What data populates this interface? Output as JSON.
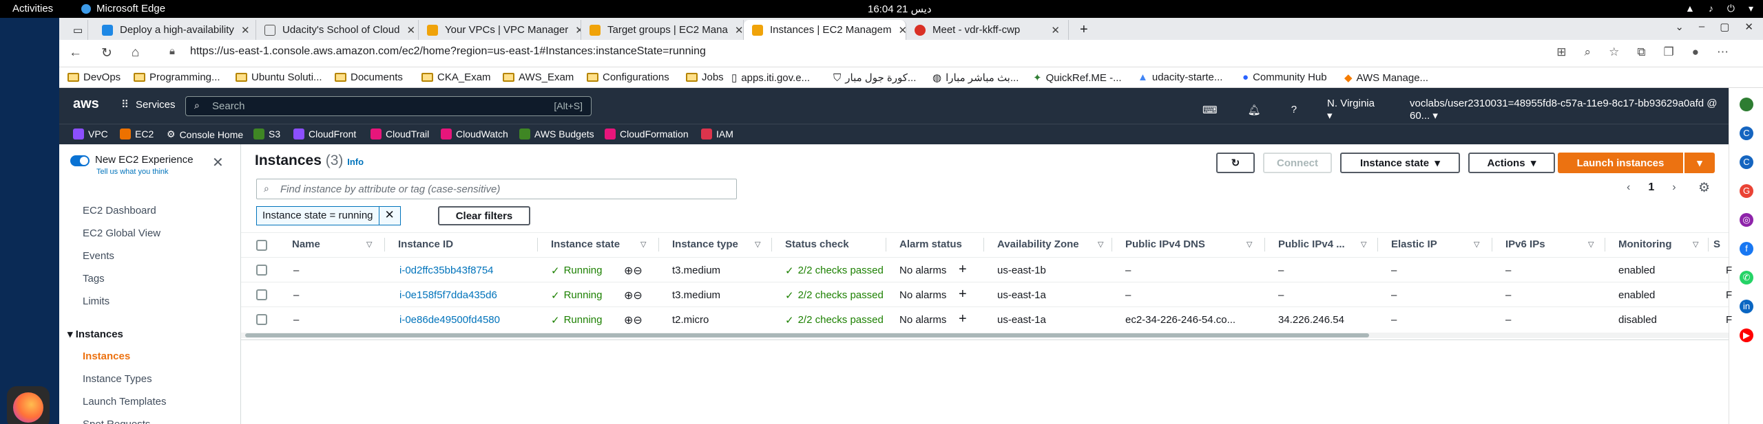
{
  "gnome": {
    "activities": "Activities",
    "app": "Microsoft Edge",
    "clock": "16:04  21 ديس"
  },
  "tabs": [
    {
      "title": "Deploy a high-availability",
      "color": "#1e88e5"
    },
    {
      "title": "Udacity's School of Cloud",
      "color": "#555"
    },
    {
      "title": "Your VPCs | VPC Manager",
      "color": "#f0a30a"
    },
    {
      "title": "Target groups | EC2 Mana",
      "color": "#f0a30a"
    },
    {
      "title": "Instances | EC2 Managem",
      "color": "#f0a30a"
    },
    {
      "title": "Meet - vdr-kkff-cwp",
      "color": "#d93025"
    }
  ],
  "url": "https://us-east-1.console.aws.amazon.com/ec2/home?region=us-east-1#Instances:instanceState=running",
  "bookmarks": [
    "DevOps",
    "Programming...",
    "Ubuntu Soluti...",
    "Documents",
    "CKA_Exam",
    "AWS_Exam",
    "Configurations",
    "Jobs",
    "apps.iti.gov.e...",
    "كورة جول مبار...",
    "بث مباشر مبارا...",
    "QuickRef.ME -...",
    "udacity-starte...",
    "Community Hub",
    "AWS Manage..."
  ],
  "aws": {
    "logo": "aws",
    "services": "Services",
    "search_placeholder": "Search",
    "search_shortcut": "[Alt+S]",
    "region": "N. Virginia",
    "account": "voclabs/user2310031=48955fd8-c57a-11e9-8c17-bb93629a0afd @ 60..."
  },
  "favorites": [
    "VPC",
    "EC2",
    "Console Home",
    "S3",
    "CloudFront",
    "CloudTrail",
    "CloudWatch",
    "AWS Budgets",
    "CloudFormation",
    "IAM"
  ],
  "leftnav": {
    "experience_title": "New EC2 Experience",
    "experience_sub": "Tell us what you think",
    "items": [
      "EC2 Dashboard",
      "EC2 Global View",
      "Events",
      "Tags",
      "Limits"
    ],
    "section": "Instances",
    "sub_items": [
      "Instances",
      "Instance Types",
      "Launch Templates",
      "Spot Requests"
    ]
  },
  "main": {
    "title": "Instances",
    "count": "(3)",
    "info": "Info",
    "connect": "Connect",
    "instance_state": "Instance state",
    "actions": "Actions",
    "launch": "Launch instances",
    "filter_placeholder": "Find instance by attribute or tag (case-sensitive)",
    "filter_token": "Instance state = running",
    "clear_filters": "Clear filters",
    "page": "1",
    "columns": [
      "Name",
      "Instance ID",
      "Instance state",
      "Instance type",
      "Status check",
      "Alarm status",
      "Availability Zone",
      "Public IPv4 DNS",
      "Public IPv4 ...",
      "Elastic IP",
      "IPv6 IPs",
      "Monitoring",
      "S"
    ],
    "rows": [
      {
        "name": "–",
        "id": "i-0d2ffc35bb43f8754",
        "state": "Running",
        "type": "t3.medium",
        "status": "2/2 checks passed",
        "alarm": "No alarms",
        "az": "us-east-1b",
        "dns": "–",
        "ipv4": "–",
        "eip": "–",
        "ipv6": "–",
        "mon": "enabled",
        "s": "F"
      },
      {
        "name": "–",
        "id": "i-0e158f5f7dda435d6",
        "state": "Running",
        "type": "t3.medium",
        "status": "2/2 checks passed",
        "alarm": "No alarms",
        "az": "us-east-1a",
        "dns": "–",
        "ipv4": "–",
        "eip": "–",
        "ipv6": "–",
        "mon": "enabled",
        "s": "F"
      },
      {
        "name": "–",
        "id": "i-0e86de49500fd4580",
        "state": "Running",
        "type": "t2.micro",
        "status": "2/2 checks passed",
        "alarm": "No alarms",
        "az": "us-east-1a",
        "dns": "ec2-34-226-246-54.co...",
        "ipv4": "34.226.246.54",
        "eip": "–",
        "ipv6": "–",
        "mon": "disabled",
        "s": "F"
      }
    ]
  }
}
